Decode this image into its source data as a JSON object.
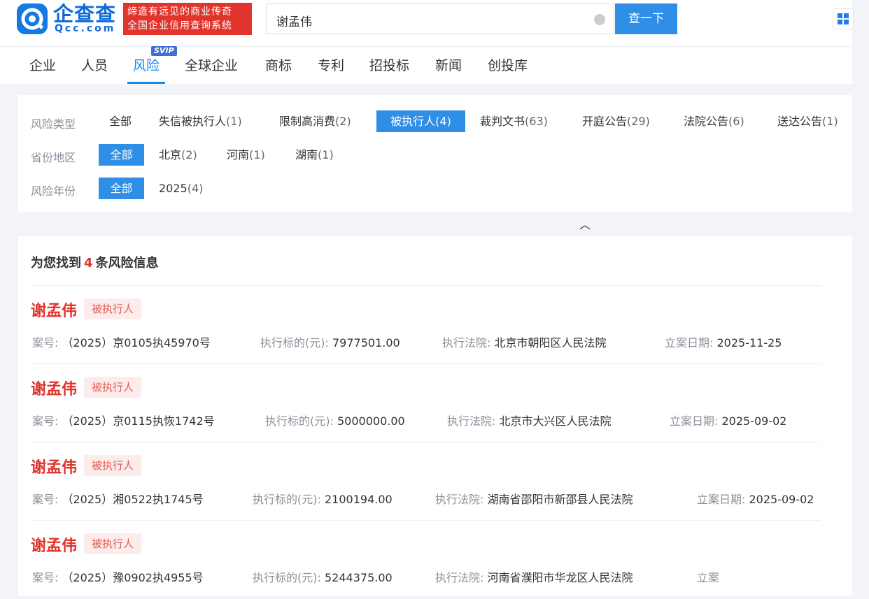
{
  "header": {
    "logo_text": "企查查",
    "logo_domain": "Qcc.com",
    "slogan_line1": "缔造有远见的商业传奇",
    "slogan_line2": "全国企业信用查询系统",
    "search_value": "谢孟伟",
    "search_button": "查一下"
  },
  "nav": {
    "tabs": [
      "企业",
      "人员",
      "风险",
      "全球企业",
      "商标",
      "专利",
      "招投标",
      "新闻",
      "创投库"
    ],
    "active_tab": "风险",
    "svip_badge": "SVIP"
  },
  "filters": {
    "risk_type": {
      "label": "风险类型",
      "options": [
        {
          "name": "全部",
          "count": ""
        },
        {
          "name": "失信被执行人",
          "count": "(1)"
        },
        {
          "name": "限制高消费",
          "count": "(2)"
        },
        {
          "name": "被执行人",
          "count": "(4)"
        },
        {
          "name": "裁判文书",
          "count": "(63)"
        },
        {
          "name": "开庭公告",
          "count": "(29)"
        },
        {
          "name": "法院公告",
          "count": "(6)"
        },
        {
          "name": "送达公告",
          "count": "(1)"
        }
      ],
      "selected": "被执行人"
    },
    "region": {
      "label": "省份地区",
      "options": [
        {
          "name": "全部",
          "count": ""
        },
        {
          "name": "北京",
          "count": "(2)"
        },
        {
          "name": "河南",
          "count": "(1)"
        },
        {
          "name": "湖南",
          "count": "(1)"
        }
      ],
      "selected": "全部"
    },
    "year": {
      "label": "风险年份",
      "options": [
        {
          "name": "全部",
          "count": ""
        },
        {
          "name": "2025",
          "count": "(4)"
        }
      ],
      "selected": "全部"
    },
    "collapse_icon": "chevron-up-icon"
  },
  "results": {
    "summary_prefix": "为您找到",
    "summary_count": "4",
    "summary_suffix": "条风险信息",
    "items": [
      {
        "name": "谢孟伟",
        "tag": "被执行人",
        "case_label": "案号:",
        "case_no": "（2025）京0105执45970号",
        "amount_label": "执行标的(元):",
        "amount": "7977501.00",
        "court_label": "执行法院:",
        "court": "北京市朝阳区人民法院",
        "date_label": "立案日期:",
        "date": "2025-11-25"
      },
      {
        "name": "谢孟伟",
        "tag": "被执行人",
        "case_label": "案号:",
        "case_no": "（2025）京0115执恢1742号",
        "amount_label": "执行标的(元):",
        "amount": "5000000.00",
        "court_label": "执行法院:",
        "court": "北京市大兴区人民法院",
        "date_label": "立案日期:",
        "date": "2025-09-02"
      },
      {
        "name": "谢孟伟",
        "tag": "被执行人",
        "case_label": "案号:",
        "case_no": "（2025）湘0522执1745号",
        "amount_label": "执行标的(元):",
        "amount": "2100194.00",
        "court_label": "执行法院:",
        "court": "湖南省邵阳市新邵县人民法院",
        "date_label": "立案日期:",
        "date": "2025-09-02"
      },
      {
        "name": "谢孟伟",
        "tag": "被执行人",
        "case_label": "案号:",
        "case_no": "（2025）豫0902执4955号",
        "amount_label": "执行标的(元):",
        "amount": "5244375.00",
        "court_label": "执行法院:",
        "court": "河南省濮阳市华龙区人民法院",
        "date_label": "立案",
        "date": ""
      }
    ]
  },
  "colors": {
    "brand_blue": "#128bed",
    "button_blue": "#2f8ee6",
    "danger_red": "#e0342d",
    "tag_bg": "#fdecec"
  }
}
